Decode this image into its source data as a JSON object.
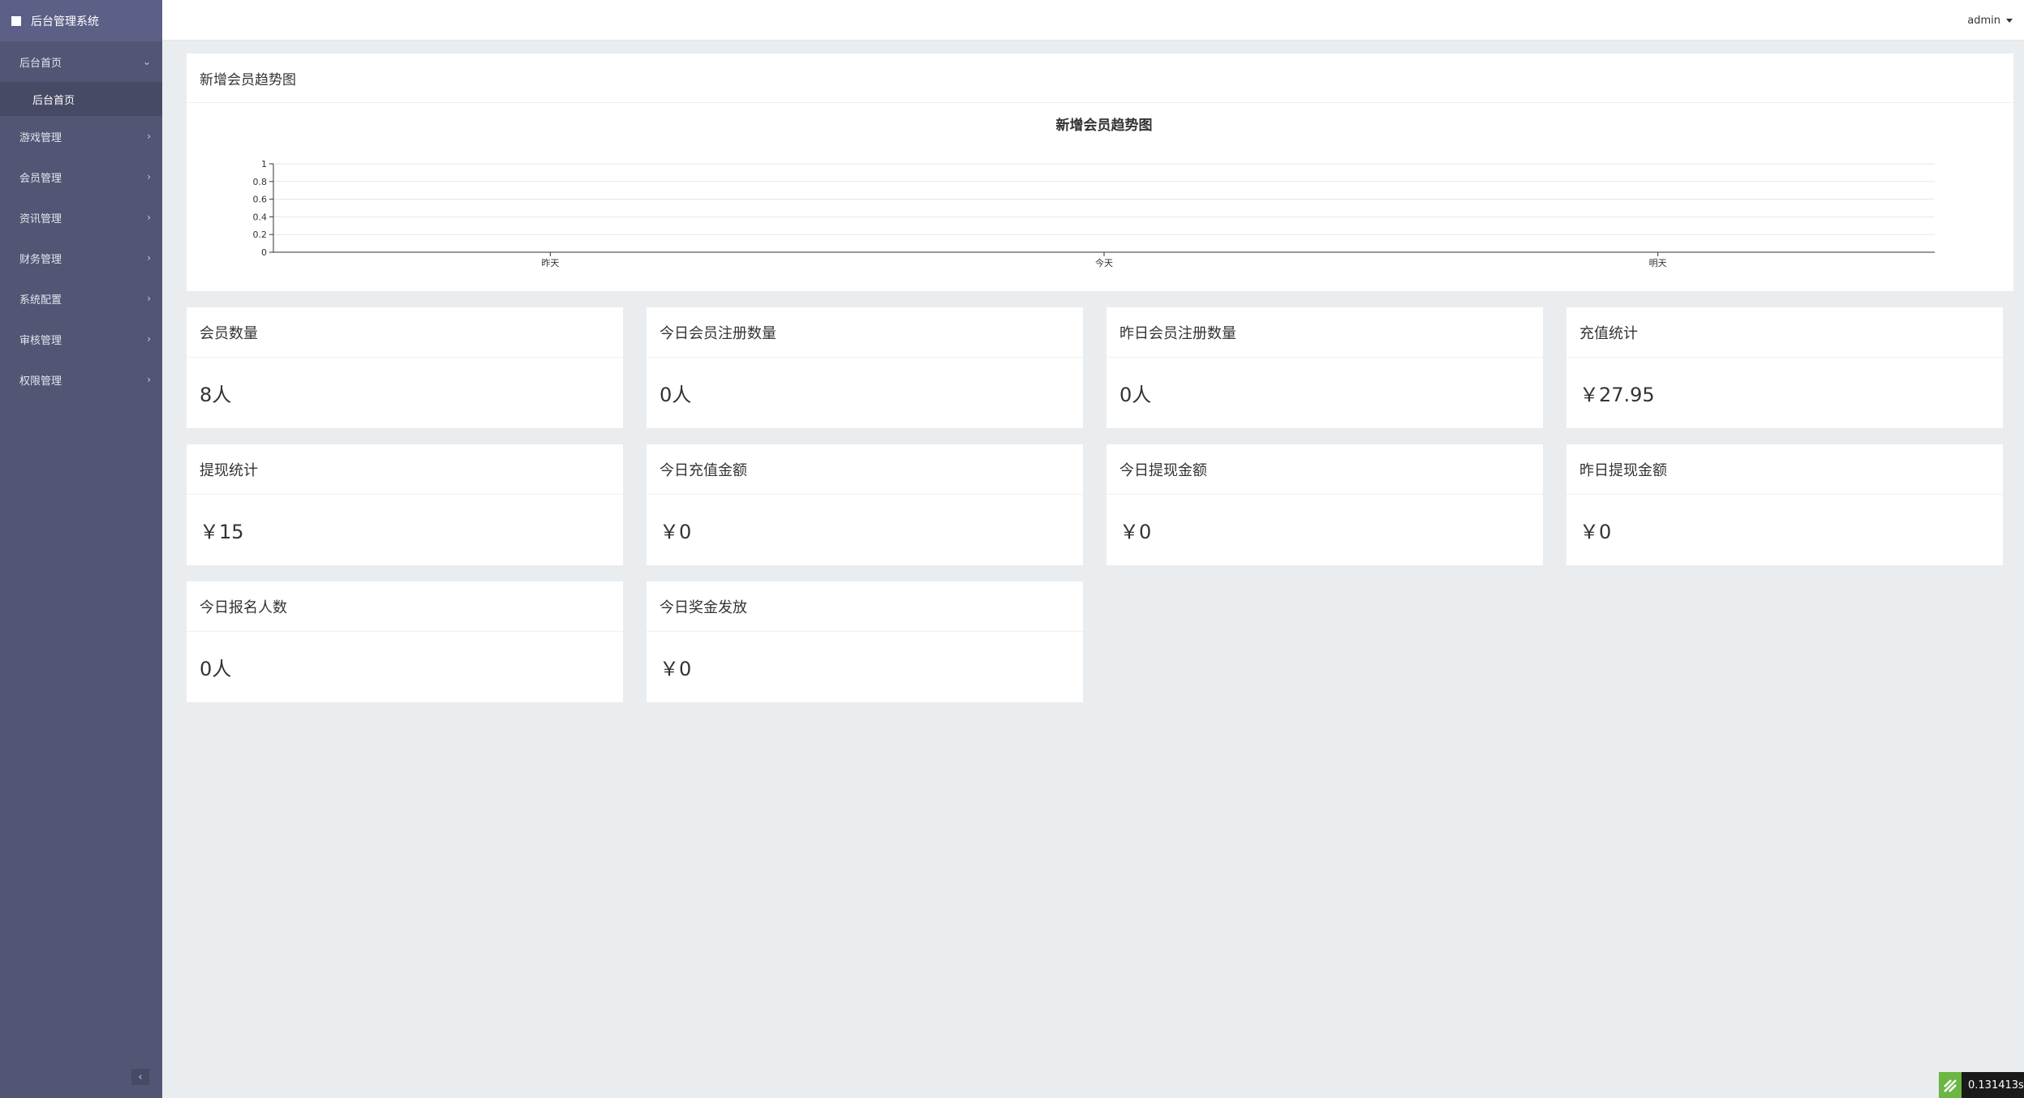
{
  "app": {
    "title": "后台管理系统"
  },
  "sidebar": {
    "items": [
      {
        "label": "后台首页",
        "icon": "chevron-down-icon",
        "children": [
          {
            "label": "后台首页"
          }
        ]
      },
      {
        "label": "游戏管理",
        "icon": "chevron-right-icon"
      },
      {
        "label": "会员管理",
        "icon": "chevron-right-icon"
      },
      {
        "label": "资讯管理",
        "icon": "chevron-right-icon"
      },
      {
        "label": "财务管理",
        "icon": "chevron-right-icon"
      },
      {
        "label": "系统配置",
        "icon": "chevron-right-icon"
      },
      {
        "label": "审核管理",
        "icon": "chevron-right-icon"
      },
      {
        "label": "权限管理",
        "icon": "chevron-right-icon"
      }
    ],
    "collapse_glyph": "‹"
  },
  "topbar": {
    "user": "admin"
  },
  "chart_panel": {
    "header": "新增会员趋势图"
  },
  "chart_data": {
    "type": "line",
    "title": "新增会员趋势图",
    "categories": [
      "昨天",
      "今天",
      "明天"
    ],
    "series": [
      {
        "values": [
          0,
          0,
          0
        ]
      }
    ],
    "ylim": [
      0,
      1
    ],
    "yticks": [
      "0",
      "0.2",
      "0.4",
      "0.6",
      "0.8",
      "1"
    ],
    "grid": true,
    "colors": {
      "axis": "#333333",
      "grid": "#e6e6e6"
    }
  },
  "cards": [
    {
      "title": "会员数量",
      "value": "8人"
    },
    {
      "title": "今日会员注册数量",
      "value": "0人"
    },
    {
      "title": "昨日会员注册数量",
      "value": "0人"
    },
    {
      "title": "充值统计",
      "value": "￥27.95"
    },
    {
      "title": "提现统计",
      "value": "￥15"
    },
    {
      "title": "今日充值金额",
      "value": "￥0"
    },
    {
      "title": "今日提现金额",
      "value": "￥0"
    },
    {
      "title": "昨日提现金额",
      "value": "￥0"
    },
    {
      "title": "今日报名人数",
      "value": "0人"
    },
    {
      "title": "今日奖金发放",
      "value": "￥0"
    }
  ],
  "badge": {
    "text": "0.131413s"
  },
  "colors": {
    "sidebar": "#525674",
    "brand": "#5c6087",
    "background": "#e9edf0"
  }
}
